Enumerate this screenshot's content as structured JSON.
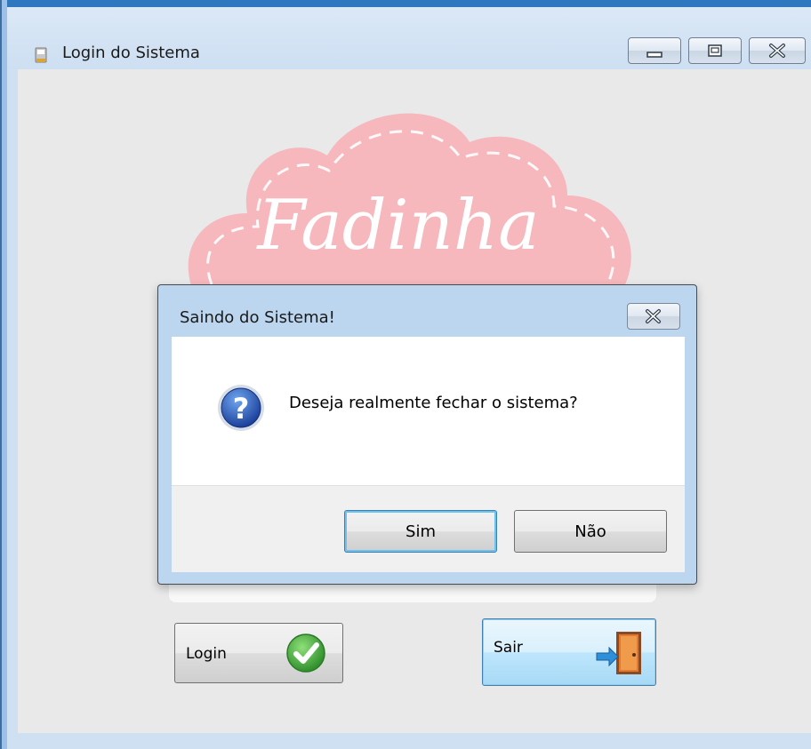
{
  "window": {
    "title": "Login do Sistema",
    "icon": "app-window-icon",
    "controls": [
      "minimize-icon",
      "maximize-icon",
      "close-icon"
    ]
  },
  "logo": {
    "text": "Fadinha",
    "cloud_color": "#f6b8bd"
  },
  "buttons": {
    "login_label": "Login",
    "login_icon": "check-icon",
    "exit_label": "Sair",
    "exit_icon": "door-exit-icon"
  },
  "dialog": {
    "title": "Saindo do Sistema!",
    "message": "Deseja realmente fechar o sistema?",
    "icon": "question-icon",
    "yes_label": "Sim",
    "no_label": "Não"
  },
  "colors": {
    "titlebar": "#cddff2",
    "client_bg": "#e9e9e9",
    "focus_blue": "#3c7fb1",
    "check_green": "#3fa43a"
  }
}
